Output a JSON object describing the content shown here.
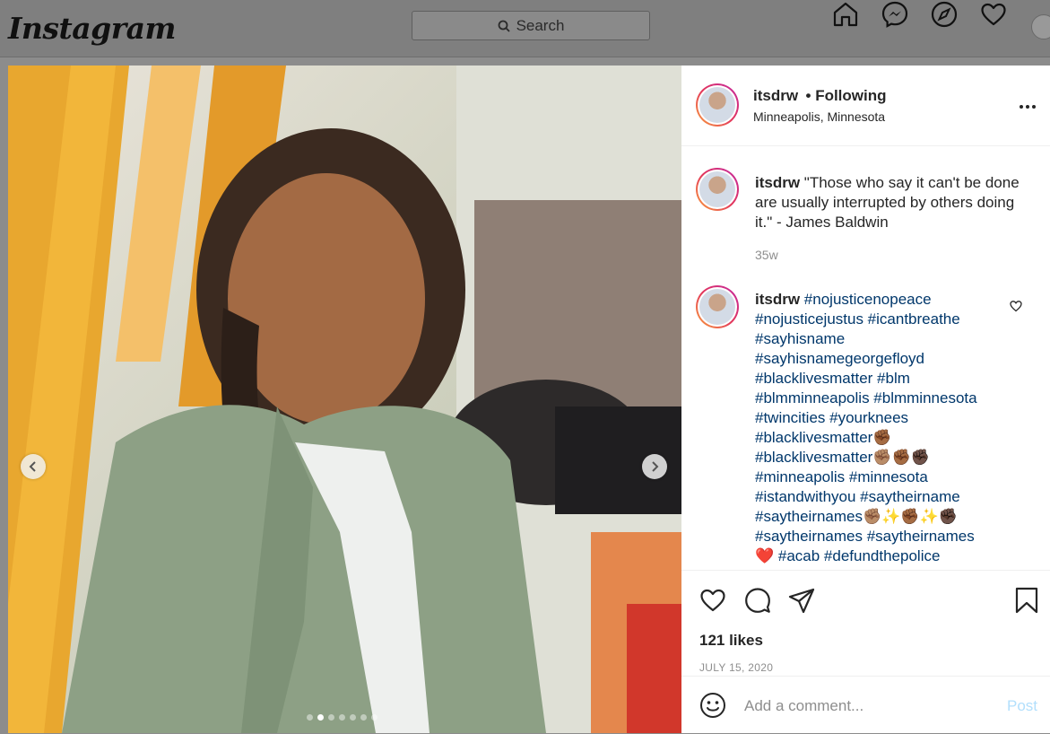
{
  "topbar": {
    "logo": "Instagram",
    "search_placeholder": "Search",
    "icons": [
      "home-icon",
      "messenger-icon",
      "explore-icon",
      "heart-icon",
      "profile-avatar"
    ]
  },
  "post": {
    "username": "itsdrw",
    "following": "• Following",
    "location": "Minneapolis, Minnesota",
    "caption": "\"Those who say it can't be done are usually interrupted by others doing it.\" - James Baldwin",
    "caption_age": "35w",
    "comment": {
      "username": "itsdrw",
      "lines": [
        "#nojusticenopeace",
        "#nojusticejustus #icantbreathe",
        "#sayhisname",
        "#sayhisnamegeorgefloyd",
        "#blacklivesmatter #blm",
        "#blmminneapolis #blmminnesota",
        "#twincities #yourknees",
        "#blacklivesmatter✊🏾",
        "#blacklivesmatter✊🏽✊🏾✊🏿",
        "#minneapolis #minnesota",
        "#istandwithyou #saytheirname",
        "#saytheirnames✊🏽✨✊🏾✨✊🏿",
        "#saytheirnames #saytheirnames",
        "❤️ #acab #defundthepolice"
      ]
    },
    "likes": "121 likes",
    "date": "JULY 15, 2020",
    "comment_placeholder": "Add a comment...",
    "post_button": "Post",
    "carousel": {
      "current_index": 2,
      "total": 7
    }
  },
  "colors": {
    "link": "#00376b",
    "muted": "#8e8e8e",
    "post_disabled": "#b2dffc"
  }
}
